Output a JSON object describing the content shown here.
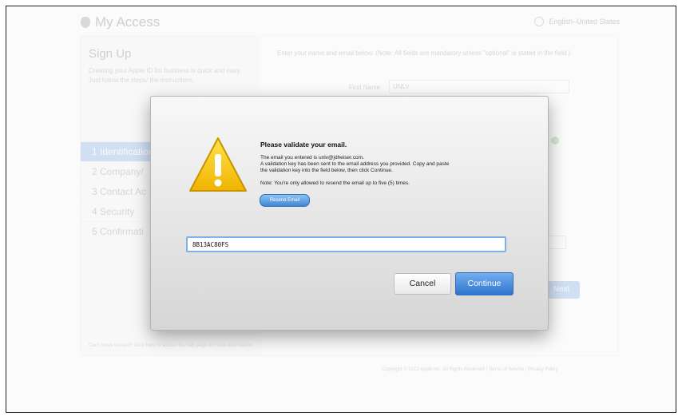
{
  "header": {
    "app_title": "My Access",
    "language": "English–United States"
  },
  "sidebar": {
    "title": "Sign Up",
    "description": "Creating your Apple ID for business is quick and easy. Just follow the steps/ the instructions.",
    "steps": [
      {
        "label": "1 Identification",
        "active": true
      },
      {
        "label": "2 Company/",
        "active": false
      },
      {
        "label": "3 Contact Ac",
        "active": false
      },
      {
        "label": "4 Security",
        "active": false
      },
      {
        "label": "5 Confirmati",
        "active": false
      }
    ],
    "footer": "Can't move forward? Click here to access the help page for more information."
  },
  "form": {
    "intro": "Enter your name and email below. (Note: All fields are mandatory unless \"optional\" is stated in the field.)",
    "first_name_label": "First Name",
    "first_name_value": "UNLV",
    "next_label": "Next"
  },
  "page_footer": "Copyright © 2012 Apple Inc. All Rights Reserved | Terms of Service | Privacy Policy",
  "dialog": {
    "icon": "warning-icon",
    "title": "Please validate your email.",
    "line1": "The email you entered is unlv@jdheiser.com.",
    "line2": "A validation key has been sent to the email address you provided. Copy and paste",
    "line3": "the validation key into the field below, then click Continue.",
    "note": "Note: You're only allowed to resend the email up to five (5) times.",
    "resend_label": "Resend Email",
    "key_value": "8B13AC80FS",
    "cancel_label": "Cancel",
    "continue_label": "Continue"
  },
  "colors": {
    "accent": "#3e7fd6",
    "warning": "#f5c400"
  }
}
